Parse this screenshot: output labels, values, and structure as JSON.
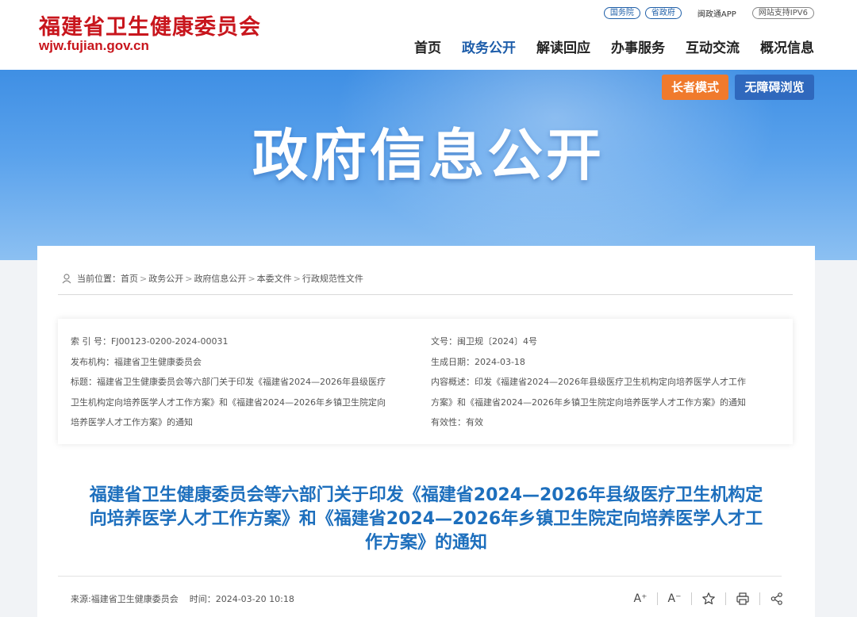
{
  "header": {
    "logo_cn": "福建省卫生健康委员会",
    "logo_en": "wjw.fujian.gov.cn",
    "top_links": [
      "国务院",
      "省政府"
    ],
    "app_link": "闽政通APP",
    "ipv6_badge": "网站支持IPV6",
    "nav": [
      "首页",
      "政务公开",
      "解读回应",
      "办事服务",
      "互动交流",
      "概况信息"
    ],
    "nav_active": "政务公开"
  },
  "banner": {
    "title": "政府信息公开",
    "elder_mode": "长者模式",
    "accessible": "无障碍浏览",
    "colors": {
      "elder": "#f07a2c",
      "accessible": "#2f68bd"
    }
  },
  "breadcrumb": {
    "prefix": "当前位置：",
    "items": [
      "首页",
      "政务公开",
      "政府信息公开",
      "本委文件",
      "行政规范性文件"
    ],
    "sep": ">"
  },
  "meta": {
    "index_label": "索 引 号：",
    "index_value": "FJ00123-0200-2024-00031",
    "publisher_label": "发布机构：",
    "publisher_value": "福建省卫生健康委员会",
    "title_label": "标题：",
    "title_lines": [
      "福建省卫生健康委员会等六部门关于印发《福建省2024—2026年县级医疗",
      "卫生机构定向培养医学人才工作方案》和《福建省2024—2026年乡镇卫生院定向",
      "培养医学人才工作方案》的通知"
    ],
    "doc_no_label": "文号：",
    "doc_no_value": "闽卫规〔2024〕4号",
    "date_label": "生成日期：",
    "date_value": "2024-03-18",
    "summary_label": "内容概述：",
    "summary_lines": [
      "印发《福建省2024—2026年县级医疗卫生机构定向培养医学人才工作",
      "方案》和《福建省2024—2026年乡镇卫生院定向培养医学人才工作方案》的通知"
    ],
    "validity_label": "有效性：",
    "validity_value": "有效"
  },
  "document": {
    "title_lines": [
      "福建省卫生健康委员会等六部门关于印发《福建省2024—2026年县级医疗卫生机构定",
      "向培养医学人才工作方案》和《福建省2024—2026年乡镇卫生院定向培养医学人才工",
      "作方案》的通知"
    ],
    "title_color": "#1d6fbd",
    "source_label": "来源:",
    "source_value": "福建省卫生健康委员会",
    "time_label": "时间：",
    "time_value": "2024-03-20 10:18"
  },
  "tools": {
    "font_up": "A⁺",
    "font_down": "A⁻"
  }
}
